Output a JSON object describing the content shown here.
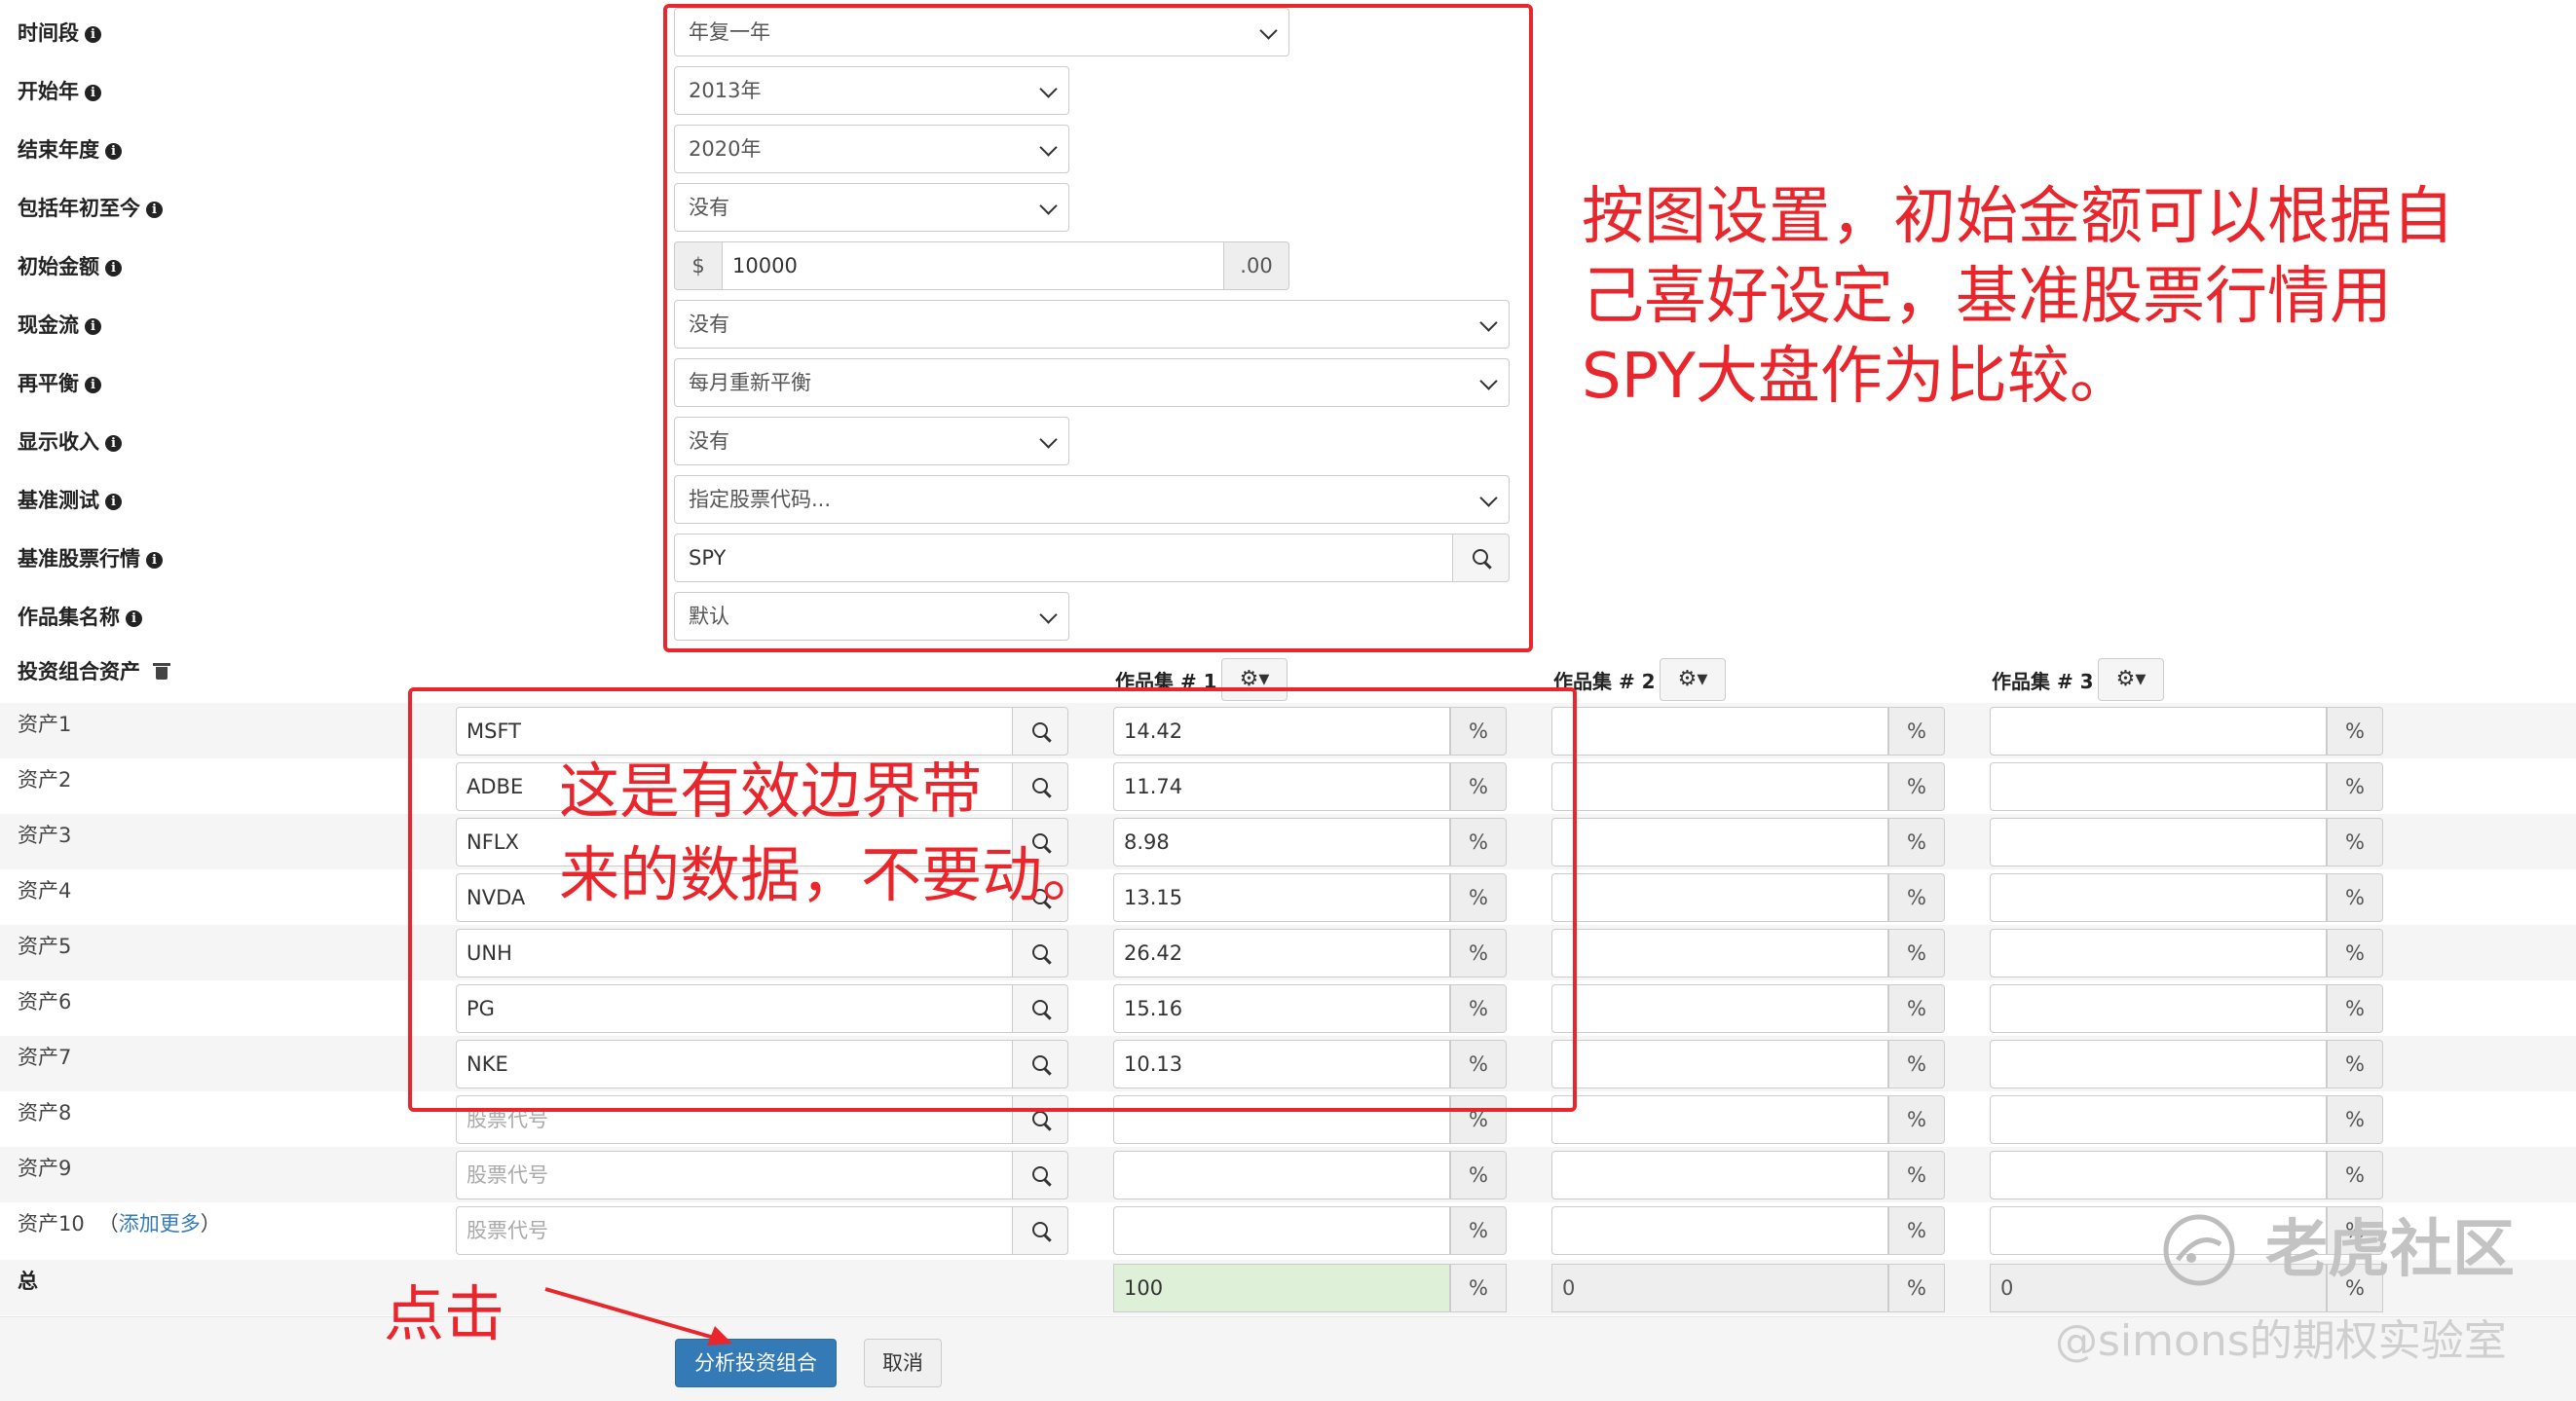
{
  "settings": {
    "timeframe": {
      "label": "时间段",
      "value": "年复一年"
    },
    "start_year": {
      "label": "开始年",
      "value": "2013年"
    },
    "end_year": {
      "label": "结束年度",
      "value": "2020年"
    },
    "ytd": {
      "label": "包括年初至今",
      "value": "没有"
    },
    "initial_amount": {
      "label": "初始金额",
      "prefix": "$",
      "value": "10000",
      "suffix": ".00"
    },
    "cashflows": {
      "label": "现金流",
      "value": "没有"
    },
    "rebalancing": {
      "label": "再平衡",
      "value": "每月重新平衡"
    },
    "show_income": {
      "label": "显示收入",
      "value": "没有"
    },
    "benchmark": {
      "label": "基准测试",
      "value": "指定股票代码..."
    },
    "benchmark_ticker": {
      "label": "基准股票行情",
      "value": "SPY"
    },
    "portfolio_names": {
      "label": "作品集名称",
      "value": "默认"
    }
  },
  "portfolio": {
    "assets_label": "投资组合资产",
    "columns": [
      "作品集 # 1",
      "作品集 # 2",
      "作品集 # 3"
    ],
    "gear_label": "⚙▾",
    "ticker_placeholder": "股票代号",
    "percent": "%",
    "add_more": "添加更多",
    "rows": [
      {
        "label": "资产1",
        "ticker": "MSFT",
        "p1": "14.42"
      },
      {
        "label": "资产2",
        "ticker": "ADBE",
        "p1": "11.74"
      },
      {
        "label": "资产3",
        "ticker": "NFLX",
        "p1": "8.98"
      },
      {
        "label": "资产4",
        "ticker": "NVDA",
        "p1": "13.15"
      },
      {
        "label": "资产5",
        "ticker": "UNH",
        "p1": "26.42"
      },
      {
        "label": "资产6",
        "ticker": "PG",
        "p1": "15.16"
      },
      {
        "label": "资产7",
        "ticker": "NKE",
        "p1": "10.13"
      },
      {
        "label": "资产8",
        "ticker": "",
        "p1": ""
      },
      {
        "label": "资产9",
        "ticker": "",
        "p1": ""
      },
      {
        "label": "资产10",
        "ticker": "",
        "p1": ""
      }
    ],
    "total": {
      "label": "总",
      "p1": "100",
      "p2": "0",
      "p3": "0"
    }
  },
  "buttons": {
    "analyze": "分析投资组合",
    "cancel": "取消"
  },
  "annotations": {
    "settings_note_1": "按图设置，初始金额可以根据自",
    "settings_note_2": "己喜好设定，基准股票行情用",
    "settings_note_3": "SPY大盘作为比较。",
    "assets_note_1": "这是有效边界带",
    "assets_note_2": "来的数据，不要动。",
    "click_note": "点击"
  },
  "watermark": {
    "brand": "老虎社区",
    "author": "@simons的期权实验室"
  },
  "colors": {
    "annotation_red": "#e8262c",
    "primary": "#337ab7",
    "total_green": "#dff0d8"
  }
}
